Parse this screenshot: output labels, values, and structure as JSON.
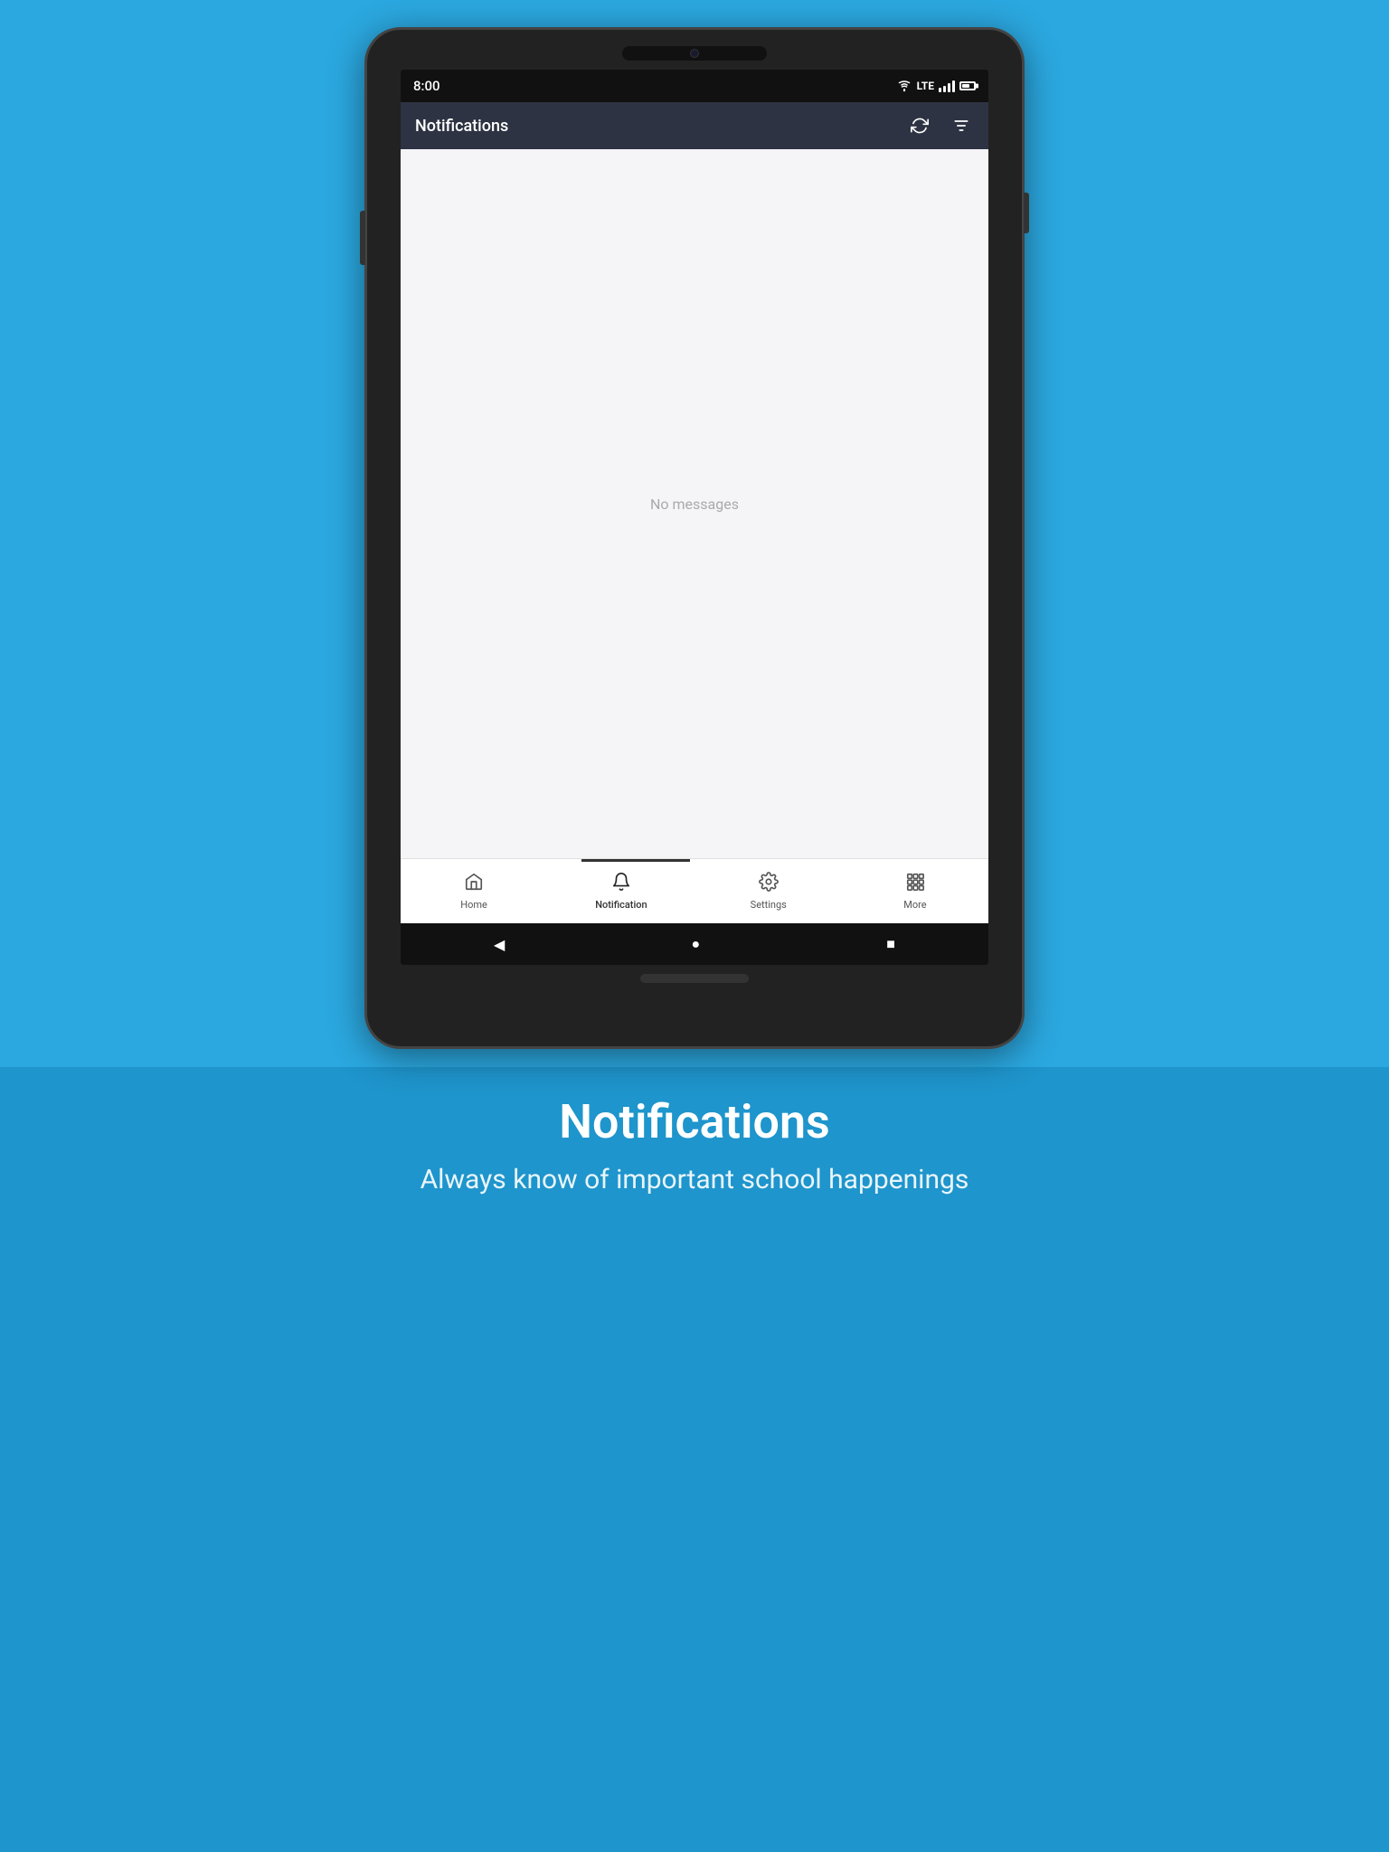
{
  "background": {
    "top_color": "#2ba8e0",
    "bottom_color": "#1e95cc"
  },
  "status_bar": {
    "time": "8:00",
    "lte_label": "LTE"
  },
  "app_bar": {
    "title": "Notifications",
    "refresh_icon": "refresh-icon",
    "filter_icon": "filter-icon"
  },
  "content": {
    "empty_message": "No messages"
  },
  "bottom_nav": {
    "items": [
      {
        "label": "Home",
        "icon": "home"
      },
      {
        "label": "Notification",
        "icon": "bell",
        "active": true
      },
      {
        "label": "Settings",
        "icon": "gear"
      },
      {
        "label": "More",
        "icon": "grid"
      }
    ]
  },
  "system_nav": {
    "back_icon": "back-arrow",
    "home_icon": "circle",
    "recent_icon": "square"
  },
  "caption": {
    "title": "Notifications",
    "subtitle": "Always know of important school happenings"
  }
}
